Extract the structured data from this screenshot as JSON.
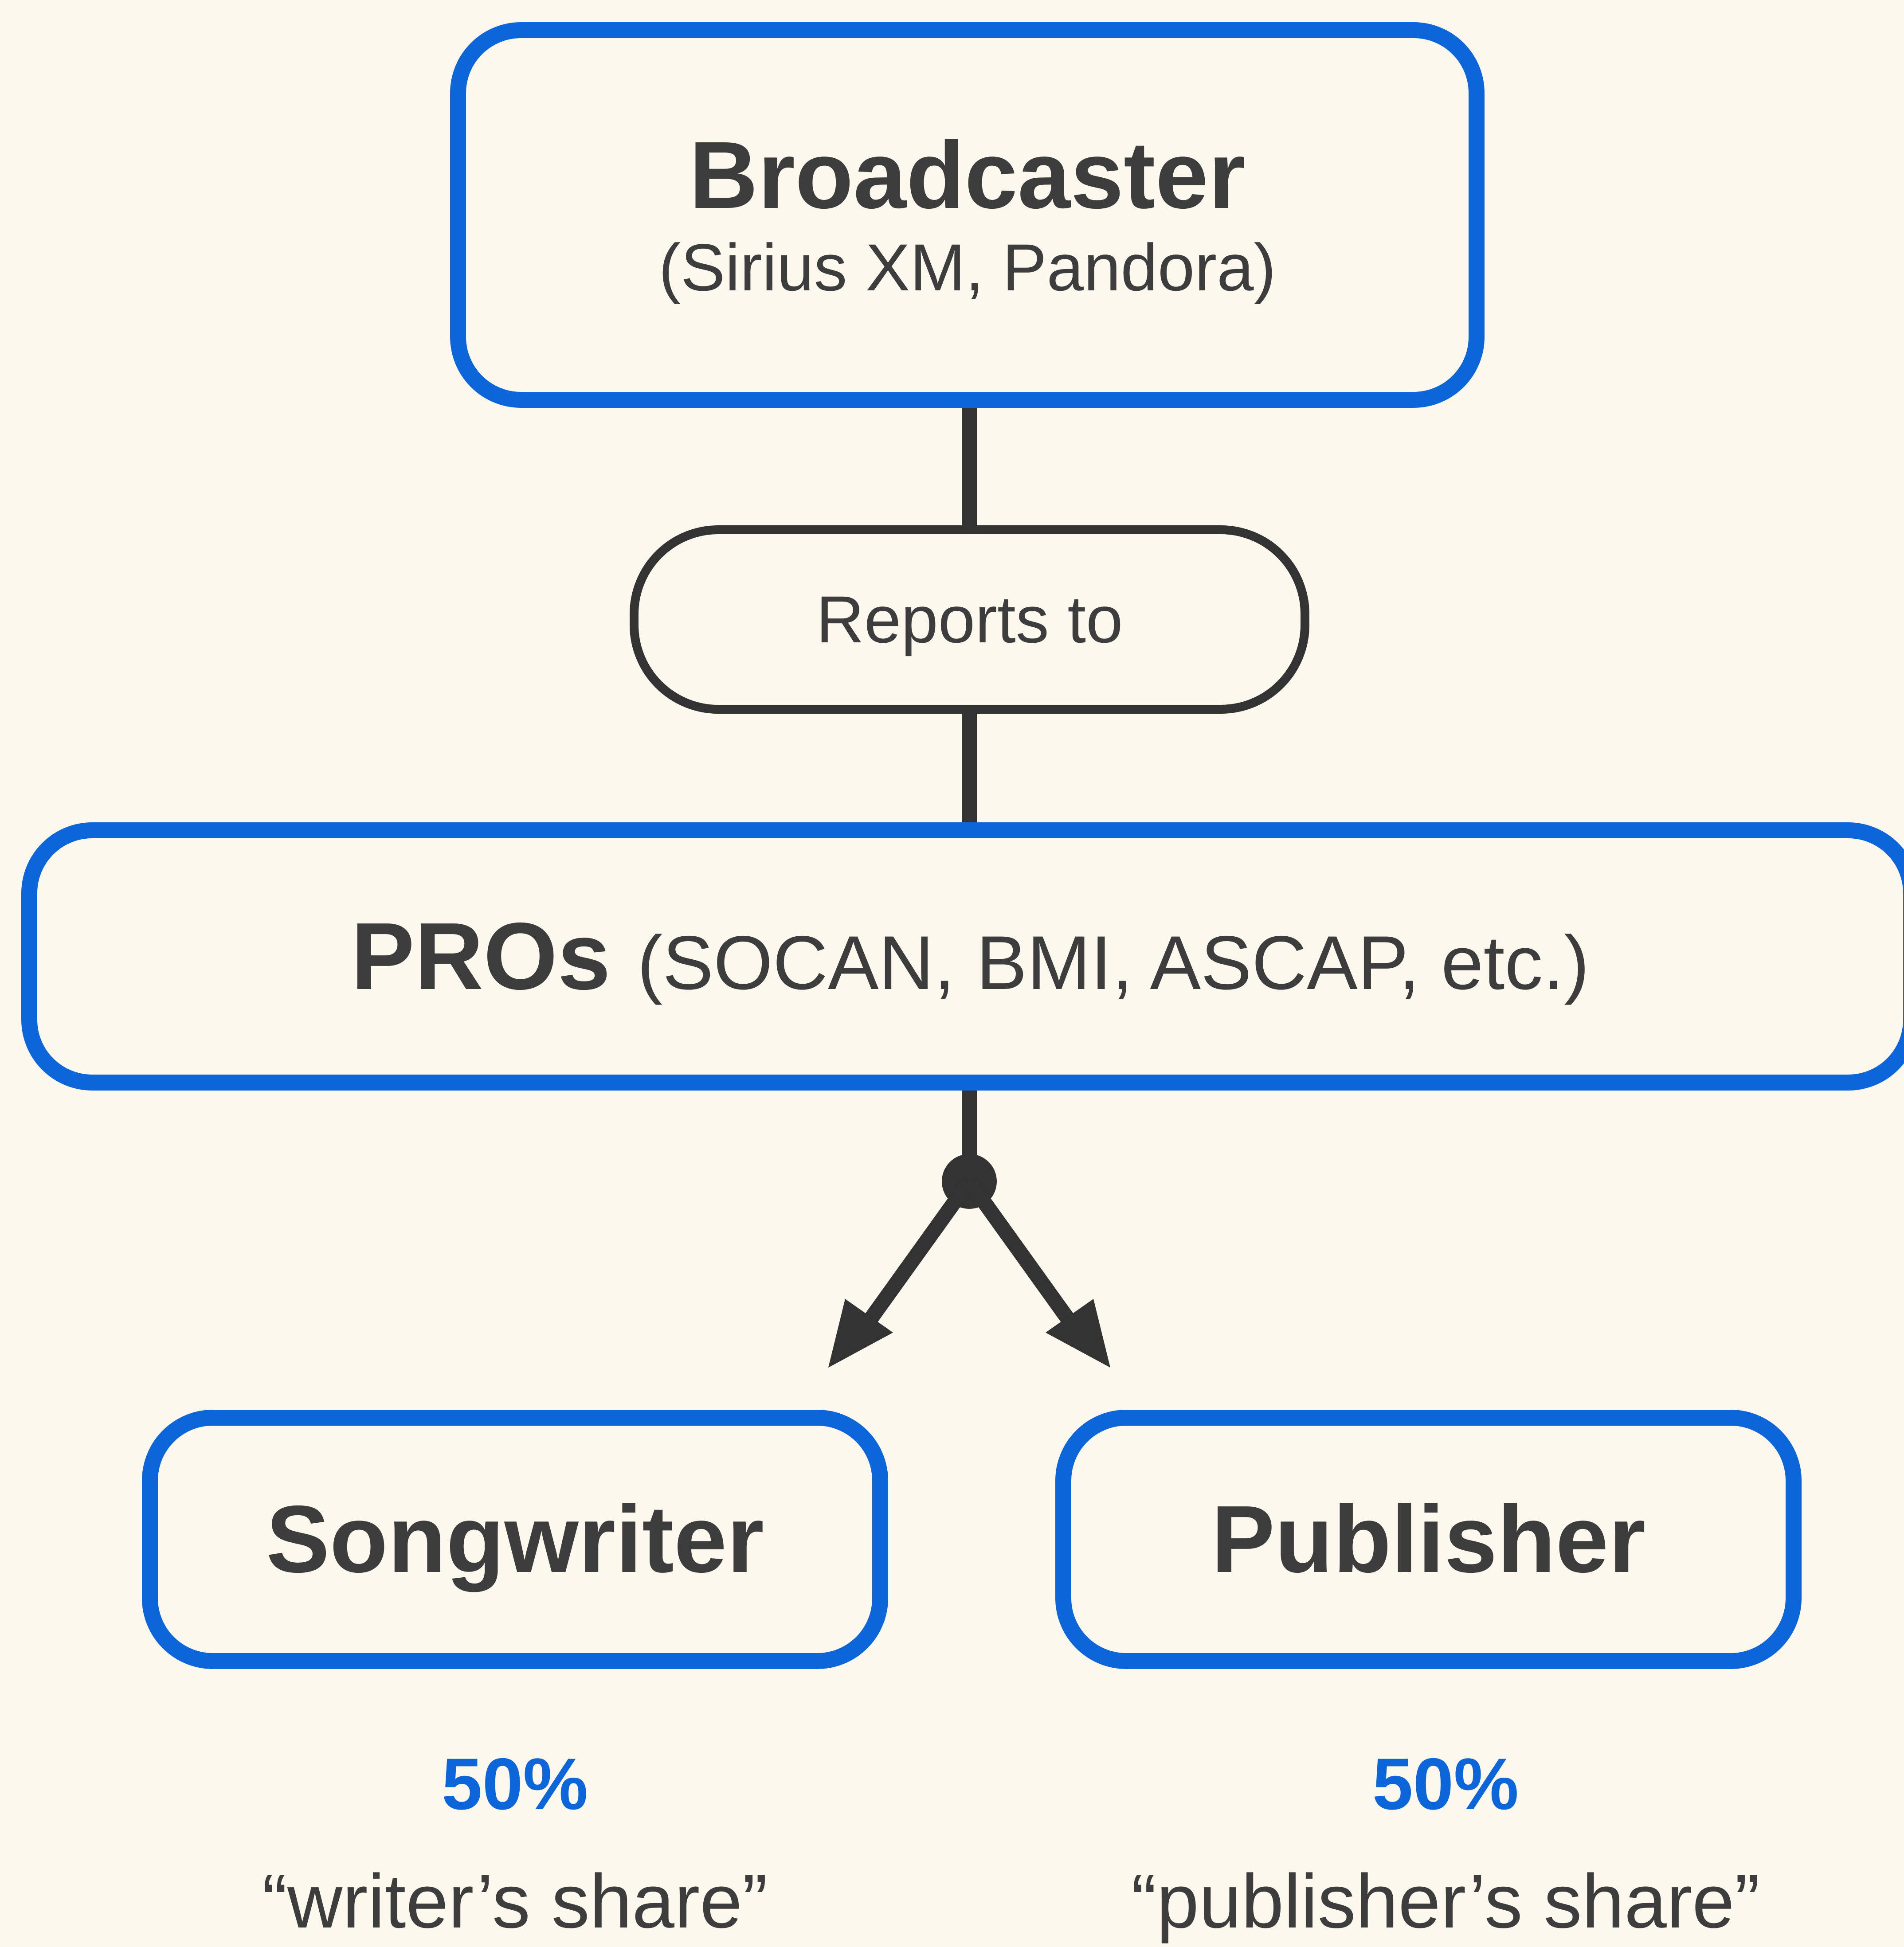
{
  "broadcaster": {
    "title": "Broadcaster",
    "subtitle": "(Sirius XM, Pandora)"
  },
  "connector_label": "Reports to",
  "pros": {
    "title": "PROs",
    "subtitle": "(SOCAN, BMI, ASCAP, etc.)"
  },
  "songwriter": {
    "title": "Songwriter",
    "percent": "50%",
    "share": "“writer’s share”"
  },
  "publisher": {
    "title": "Publisher",
    "percent": "50%",
    "share": "“publisher’s share”"
  },
  "colors": {
    "background": "#fcf8ee",
    "accent": "#0d66d9",
    "text": "#3d3d3d",
    "connector": "#333333"
  }
}
